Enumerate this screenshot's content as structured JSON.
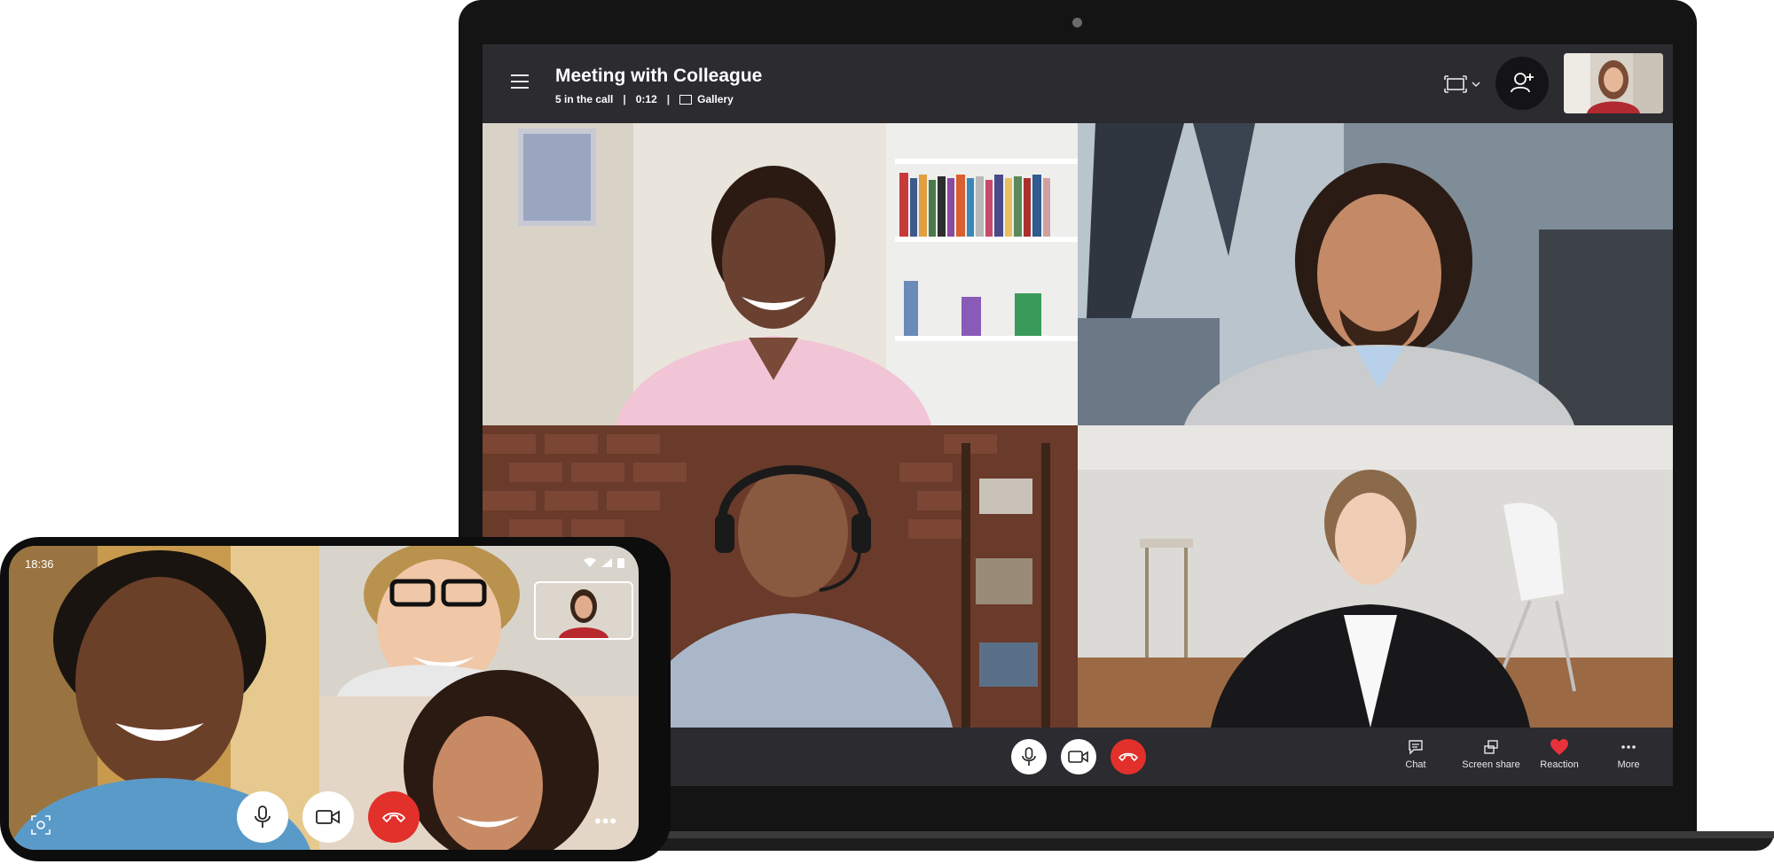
{
  "meeting": {
    "title": "Meeting with Colleague",
    "participants": "5 in the call",
    "duration": "0:12",
    "view": "Gallery"
  },
  "participants_grid": [
    {
      "label": "woman in pink shirt, bookshelf background"
    },
    {
      "label": "bearded man in grey sweater"
    },
    {
      "label": "man wearing headset, brick wall background"
    },
    {
      "label": "woman in black blazer, office background"
    }
  ],
  "bottom_actions": [
    {
      "label": "Chat",
      "icon": "chat-icon"
    },
    {
      "label": "Screen share",
      "icon": "screen-share-icon"
    },
    {
      "label": "Reaction",
      "icon": "heart-icon"
    },
    {
      "label": "More",
      "icon": "more-icon"
    }
  ],
  "colors": {
    "end_call": "#e2302b",
    "bar": "#2b2b30",
    "reaction_heart": "#e8323c"
  },
  "phone": {
    "time": "18:36"
  }
}
